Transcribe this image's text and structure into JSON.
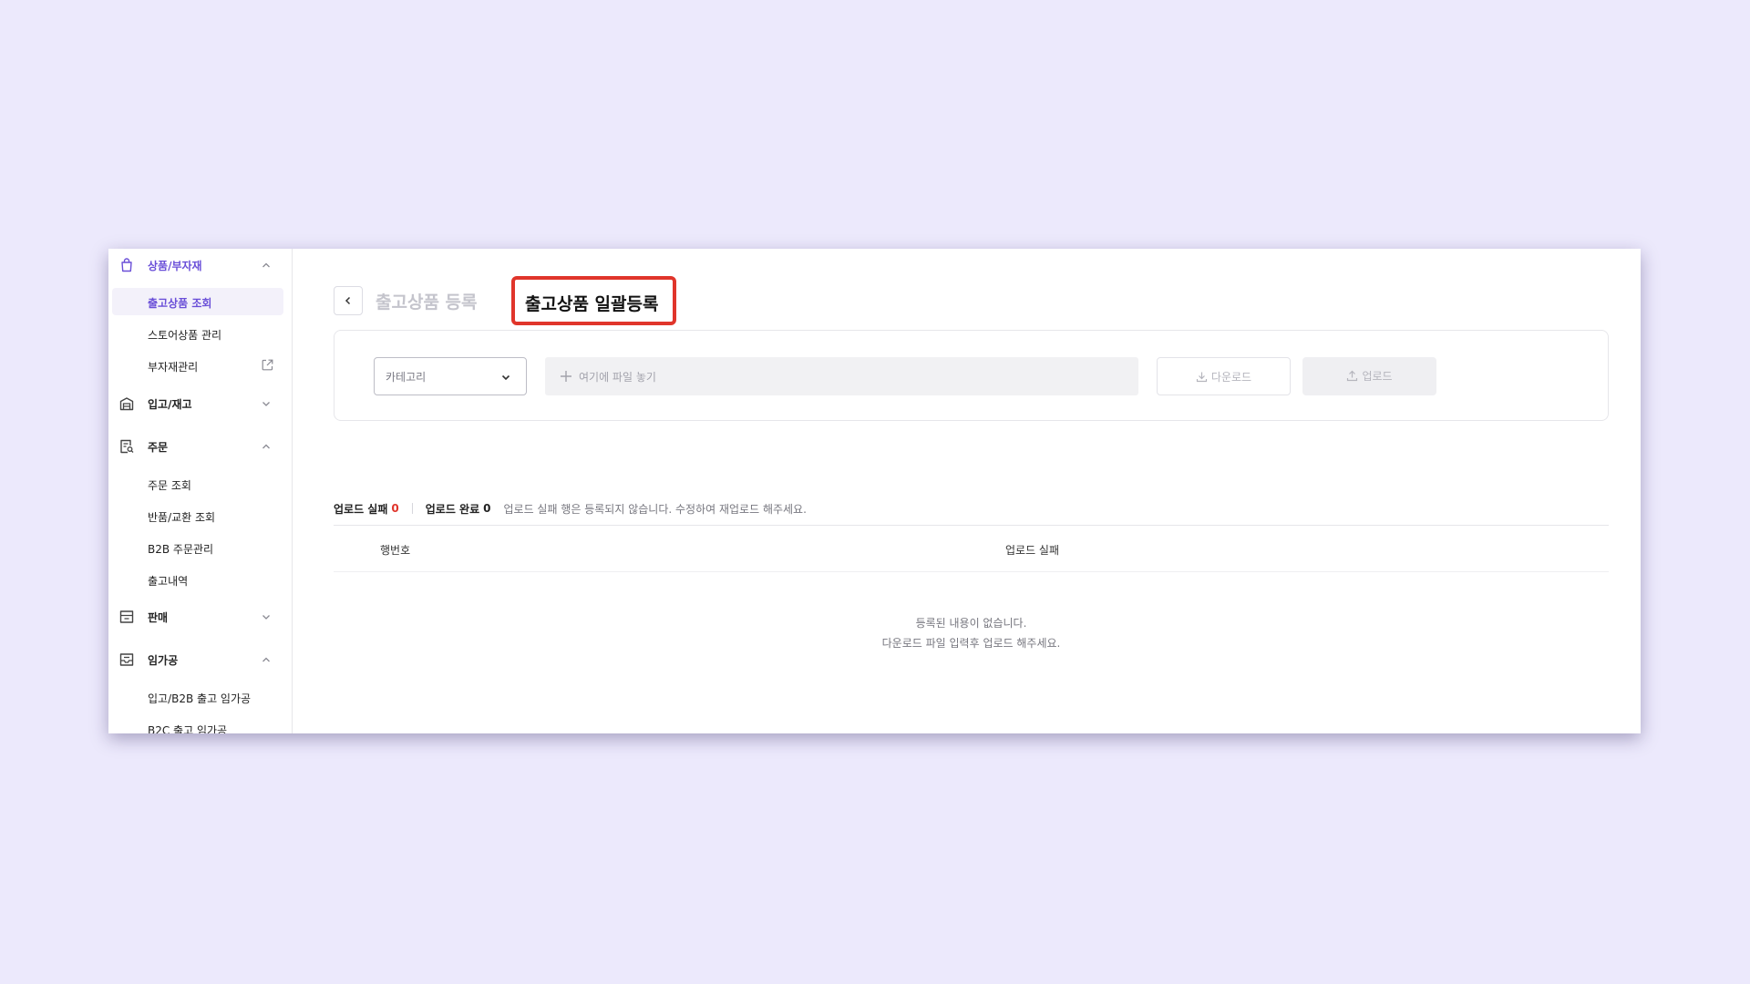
{
  "sidebar": {
    "sections": [
      {
        "label": "상품/부자재",
        "icon": "shopping-bag-icon",
        "expanded": true,
        "active": true,
        "items": [
          {
            "label": "출고상품 조회",
            "selected": true
          },
          {
            "label": "스토어상품 관리"
          },
          {
            "label": "부자재관리",
            "icon": "external-link-icon"
          }
        ]
      },
      {
        "label": "입고/재고",
        "icon": "warehouse-icon",
        "expanded": false
      },
      {
        "label": "주문",
        "icon": "order-search-icon",
        "expanded": true,
        "items": [
          {
            "label": "주문 조회"
          },
          {
            "label": "반품/교환 조회"
          },
          {
            "label": "B2B 주문관리"
          },
          {
            "label": "출고내역"
          }
        ]
      },
      {
        "label": "판매",
        "icon": "store-icon",
        "expanded": false
      },
      {
        "label": "임가공",
        "icon": "inbox-icon",
        "expanded": true,
        "items": [
          {
            "label": "입고/B2B 출고 임가공"
          },
          {
            "label": "B2C 출고 임가공"
          }
        ]
      }
    ]
  },
  "header": {
    "tab_inactive": "출고상품 등록",
    "tab_active": "출고상품 일괄등록"
  },
  "upload_panel": {
    "category_value": "카테고리",
    "dropzone_label": "여기에 파일 놓기",
    "download_label": "다운로드",
    "upload_label": "업로드"
  },
  "summary": {
    "fail_label": "업로드 실패",
    "fail_count": "0",
    "success_label": "업로드 완료",
    "success_count": "0",
    "note": "업로드 실패 행은 등록되지 않습니다. 수정하여 재업로드 해주세요."
  },
  "table": {
    "columns": [
      "행번호",
      "업로드 실패"
    ],
    "empty_line1": "등록된 내용이 없습니다.",
    "empty_line2": "다운로드 파일 입력후 업로드 해주세요."
  },
  "colors": {
    "accent": "#6a4fd8",
    "highlight_border": "#e0352b",
    "background": "#ece9fc"
  }
}
